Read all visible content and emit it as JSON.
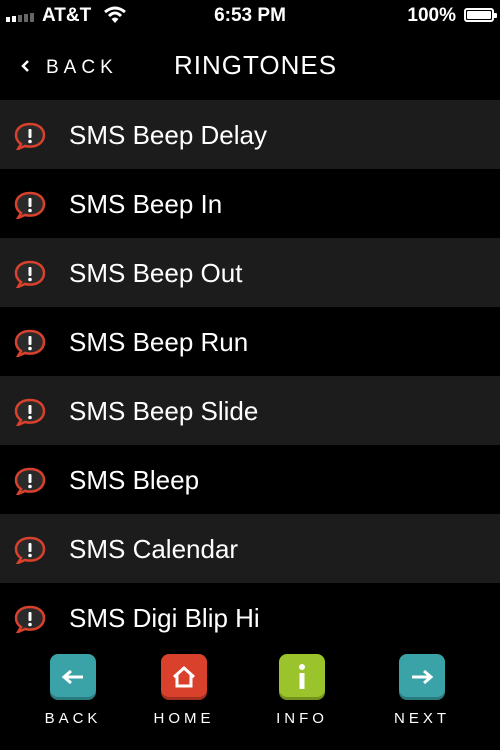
{
  "status_bar": {
    "carrier": "AT&T",
    "time": "6:53 PM",
    "battery": "100%"
  },
  "nav": {
    "back_label": "BACK",
    "title": "RINGTONES"
  },
  "ringtones": [
    "SMS Beep Delay",
    "SMS Beep In",
    "SMS Beep Out",
    "SMS Beep Run",
    "SMS Beep Slide",
    "SMS Bleep",
    "SMS Calendar",
    "SMS Digi Blip Hi"
  ],
  "toolbar": {
    "back": "BACK",
    "home": "HOME",
    "info": "INFO",
    "next": "NEXT"
  },
  "colors": {
    "teal_button": "#3aa3a8",
    "red_button": "#d9412c",
    "green_button": "#9bc32b",
    "alert_icon_ring": "#d9412c"
  }
}
